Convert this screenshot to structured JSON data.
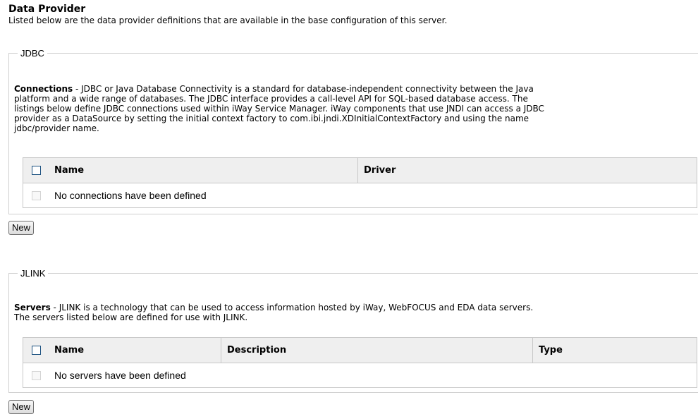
{
  "header": {
    "title": "Data Provider",
    "subtitle": "Listed below are the data provider definitions that are available in the base configuration of this server."
  },
  "jdbc": {
    "legend": "JDBC",
    "desc_bold": "Connections",
    "desc_line1": " - JDBC or Java Database Connectivity is a standard for database-independent connectivity between the Java",
    "desc_line2": "platform and a wide range of databases. The JDBC interface provides a call-level API for SQL-based database access. The",
    "desc_line3": "listings below define JDBC connections used within iWay Service Manager. iWay components that use JNDI can access a JDBC",
    "desc_line4": "provider as a DataSource by setting the initial context factory to com.ibi.jndi.XDInitialContextFactory and using the name",
    "desc_line5": "jdbc/provider name.",
    "columns": [
      "Name",
      "Driver"
    ],
    "empty_text": "No connections have been defined",
    "new_label": "New"
  },
  "jlink": {
    "legend": "JLINK",
    "desc_bold": "Servers",
    "desc_line1": " - JLINK is a technology that can be used to access information hosted by iWay, WebFOCUS and EDA data servers.",
    "desc_line2": "The servers listed below are defined for use with JLINK.",
    "columns": [
      "Name",
      "Description",
      "Type"
    ],
    "empty_text": "No servers have been defined",
    "new_label": "New"
  }
}
